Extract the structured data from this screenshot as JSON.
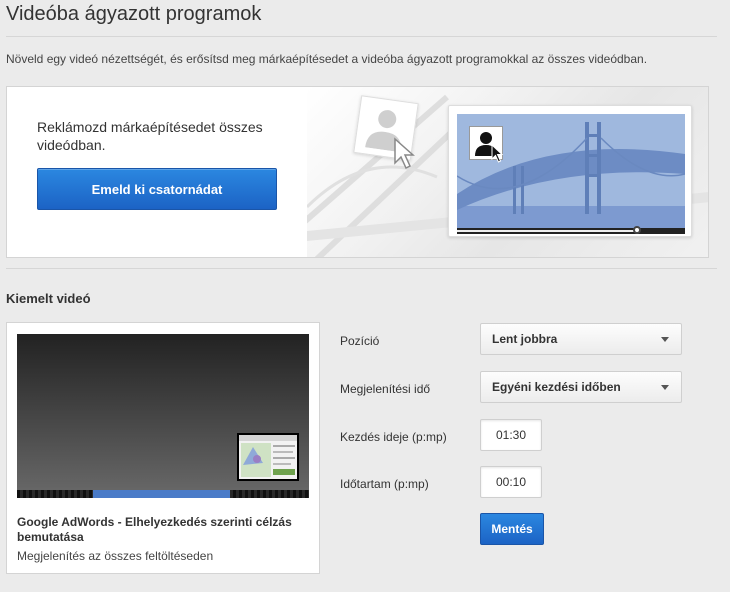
{
  "page": {
    "title": "Videóba ágyazott programok",
    "description": "Növeld egy videó nézettségét, és erősítsd meg márkaépítésedet a videóba ágyazott programokkal az összes videódban."
  },
  "promo": {
    "text": "Reklámozd márkaépítésedet összes videódban.",
    "button_label": "Emeld ki csatornádat",
    "preview_progress": 0.79
  },
  "featured": {
    "section_title": "Kiemelt videó",
    "video_title": "Google AdWords - Elhelyezkedés szerinti célzás bemutatása",
    "video_subtitle": "Megjelenítés az összes feltöltéseden",
    "progress_start": 0.26,
    "progress_end": 0.73
  },
  "form": {
    "position_label": "Pozíció",
    "position_value": "Lent jobbra",
    "display_time_label": "Megjelenítési idő",
    "display_time_value": "Egyéni kezdési időben",
    "start_label": "Kezdés ideje (p:mp)",
    "start_value": "01:30",
    "duration_label": "Időtartam (p:mp)",
    "duration_value": "00:10",
    "save_label": "Mentés"
  },
  "colors": {
    "accent": "#1f6fd0",
    "background": "#ebebeb"
  },
  "icons": {
    "avatar": "person-silhouette-icon",
    "cursor": "mouse-pointer-icon",
    "dropdown": "caret-down-icon"
  }
}
